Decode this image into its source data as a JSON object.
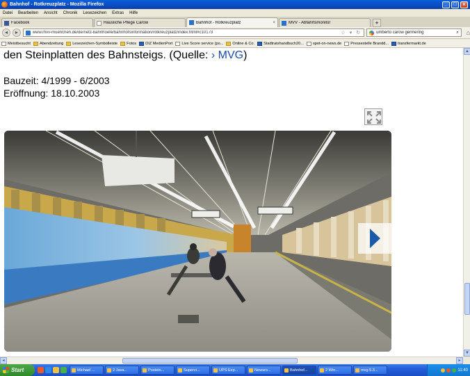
{
  "window": {
    "title": "Bahnhof - Rotkreuzplatz - Mozilla Firefox",
    "controls": [
      "_",
      "□",
      "x"
    ]
  },
  "menu": [
    "Datei",
    "Bearbeiten",
    "Ansicht",
    "Chronik",
    "Lesezeichen",
    "Extras",
    "Hilfe"
  ],
  "tabs": [
    {
      "label": "Facebook",
      "active": false
    },
    {
      "label": "Häusliche Pflege Carow",
      "active": false
    },
    {
      "label": "Bahnhof - Rotkreuzplatz",
      "active": true
    },
    {
      "label": "MVV - Abfahrtsmonitor",
      "active": false
    }
  ],
  "newtab_label": "+",
  "nav": {
    "url": "www.mvv-muenchen.de/de/netz-bahnhoefe/bahnhofsinformation/rotkreuzplatz/index.html#c10173",
    "search_query": "umberto carow germering"
  },
  "bookmarks": [
    "Meistbesucht",
    "Abendzeitung",
    "Lesezeichen-Symbolleiste",
    "Fotos",
    "DIZ MedienPort",
    "Live Score service (po...",
    "Online & Co.",
    "Stadtratshandbuch20...",
    "spot-on-news.de",
    "Pressestelle Brandd...",
    "transfermarkt.de"
  ],
  "content": {
    "line1_text": "den Steinplatten des Bahnsteigs. (Quelle: ",
    "line1_link_arrow": "›",
    "line1_link": "MVG",
    "line1_close": ")",
    "bauzeit": "Bauzeit: 4/1999 - 6/2003",
    "eroeffnung": "Eröffnung: 18.10.2003"
  },
  "taskbar": {
    "start_label": "Start",
    "tasks": [
      {
        "label": "Michael ...",
        "active": false
      },
      {
        "label": "2 Java...",
        "active": false
      },
      {
        "label": "Postein...",
        "active": false
      },
      {
        "label": "Supervi...",
        "active": false
      },
      {
        "label": "UPS Exp...",
        "active": false
      },
      {
        "label": "Newsro...",
        "active": false
      },
      {
        "label": "Bahnhof...",
        "active": true
      },
      {
        "label": "2 Win...",
        "active": false
      },
      {
        "label": "mvg 5.3...",
        "active": false
      }
    ],
    "clock": "11:40"
  },
  "colors": {
    "link": "#1a4aa8",
    "titlebar": "#0b4cc2",
    "taskbar": "#245edb",
    "next_arrow": "#1a5aa8"
  }
}
